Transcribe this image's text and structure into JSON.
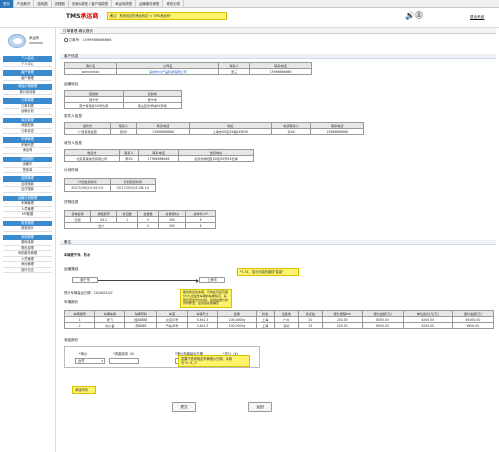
{
  "topbar": {
    "tabs": [
      "首页",
      "产品概况",
      "结构图",
      "流程图",
      "页面&原型 / 客户端原型",
      "承运商原型",
      "运输服务原型",
      "修改记录"
    ]
  },
  "header": {
    "logo_prefix": "TMS",
    "logo_suffix": "承运商",
    "note": "备注：系统设定的承运商名\"< TMS承运商\"",
    "icons": "🔊⓼",
    "logout": "退出系统"
  },
  "sidebar": {
    "profile_name": "承运商",
    "profile_sub": "xxxxxxx",
    "menu": [
      {
        "cat": "个人信息",
        "items": [
          "个人中心"
        ]
      },
      {
        "cat": "客户管理",
        "items": [
          "客户管理"
        ]
      },
      {
        "cat": "承运价格管理",
        "items": [
          "报价单设置"
        ]
      },
      {
        "cat": "订单管理",
        "items": [
          "订单列表",
          "运输计划"
        ]
      },
      {
        "cat": "库存管理",
        "items": [
          "调度配置",
          "订单状态"
        ]
      },
      {
        "cat": "车辆管理",
        "items": [
          "车辆列表",
          "承运商"
        ]
      },
      {
        "cat": "运输跟踪",
        "items": [
          "运输中",
          "签收单"
        ]
      },
      {
        "cat": "结算管理",
        "items": [
          "应收账款",
          "应付账款"
        ]
      },
      {
        "cat": "运输计划管理",
        "items": [
          "车辆管理",
          "人员管理",
          "KPI数据"
        ]
      },
      {
        "cat": "财务管理",
        "items": [
          "费用统计"
        ]
      },
      {
        "cat": "系统管理",
        "items": [
          "基础设置",
          "角色权限",
          "司机服务管理",
          "人员管理",
          "承运管理",
          "操作日志"
        ]
      }
    ]
  },
  "breadcrumb": "订单管理-确认报价",
  "order_no": "订单号：1599966666666",
  "customer": {
    "title": "客户信息",
    "headers": [
      "客户名",
      "公司名",
      "联系人",
      "联系电话"
    ],
    "row": [
      "samsenhon",
      "深圳市xx产品科技有限公司",
      "张三",
      "15966666666"
    ]
  },
  "shipping_addr": {
    "title": "运输地址",
    "headers": [
      "起始地",
      "目的地"
    ],
    "row": [
      "南宁市",
      "南宁市"
    ],
    "row2": [
      "南宁青秀区XX号仓库",
      "南山区华侨城XX商场"
    ]
  },
  "sender": {
    "title": "发件人信息",
    "headers": [
      "发件方",
      "联系人",
      "联系电话",
      "地址",
      "收货联系人",
      "联系电话"
    ],
    "row": [
      "广西某某集团",
      "张XX",
      "13966666666",
      "上海市XX区XX路XX号XX",
      "孙XX",
      "13966666666"
    ]
  },
  "receiver": {
    "title": "收货人信息",
    "headers": [
      "收货方",
      "联系人",
      "联系电话",
      "送货地址"
    ],
    "row": [
      "北京某某物流有限公司",
      "李XX",
      "17966666666",
      "北京市朝阳区XX街XX号XX仓库"
    ]
  },
  "plan_time": {
    "title": "计划时间",
    "headers": [
      "计划发货时间",
      "计划到货时间"
    ],
    "row": [
      "2017/09/24 09:10",
      "2017/09/24 08:10"
    ]
  },
  "goods": {
    "title": "货物信息",
    "headers": [
      "货物名称",
      "规格型号",
      "总包数",
      "总数量",
      "总重量kg",
      "总体积 m³"
    ],
    "row": [
      "空调",
      "XX-1",
      "1",
      "3",
      "300",
      "6"
    ],
    "total_label": "合计",
    "total": [
      "",
      "",
      "",
      "3",
      "300",
      "6"
    ]
  },
  "remark": {
    "title": "备注",
    "text": "车辆要干净、防水"
  },
  "route": {
    "title": "运输路线",
    "from": "南宁市",
    "to": "上海市",
    "note": "*1.51、显示可能的路线\"智能\""
  },
  "load_date": "预计车辆装运日期：2018/05/02",
  "vehicles": {
    "title": "车辆报价",
    "note": "路线的最优车辆，可向在同最高报价5%出最优车辆的车辆情况，系统匹配最优价价格，提供在报价的列内修改，最终由系统确定",
    "headers": [
      "车辆编号",
      "车辆车牌",
      "车辆司机",
      "车型",
      "车辆尺寸",
      "载重",
      "状态",
      "出发地",
      "终点站",
      "报价里程km",
      "报价金额(元)",
      "单位运价(元/元)",
      "报价金额(元)"
    ],
    "rows": [
      [
        "1",
        "张飞",
        "桂A8888",
        "北京/C号",
        "5.8x2.3",
        "100,000kg",
        "上海",
        "广州",
        "20",
        "200.00",
        "8000.00",
        "¥200.00",
        "¥4000.00"
      ],
      [
        "2",
        "刘小备",
        "苏B888",
        "汽车/D号",
        "3.8x2.3",
        "100,000kg",
        "上海",
        "深圳",
        "15",
        "200.00",
        "8000.00",
        "¥200.00",
        "¥600.00"
      ]
    ]
  },
  "add_quote": {
    "title": "添加报价",
    "headers": [
      "*单价",
      "*调度费用（¥）",
      "*报价车辆装运日期",
      "*发计（¥）"
    ],
    "select_value": "台湾",
    "date_value": "——",
    "note_left": "添加时间",
    "note_right": "如果产品有相应车辆报价日期，请填写\"5~6_3\""
  },
  "buttons": {
    "submit": "提交",
    "back": "返回"
  }
}
